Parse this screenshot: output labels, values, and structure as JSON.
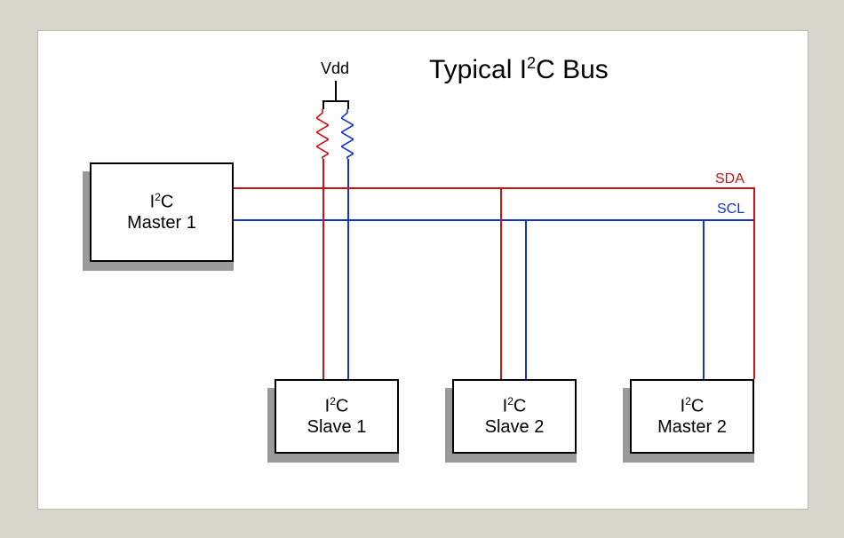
{
  "title_prefix": "Typical I",
  "title_sup": "2",
  "title_suffix": "C Bus",
  "vdd_label": "Vdd",
  "bus": {
    "sda_label": "SDA",
    "scl_label": "SCL"
  },
  "devices": {
    "master1": {
      "line1_pre": "I",
      "line1_sup": "2",
      "line1_post": "C",
      "line2": "Master 1"
    },
    "slave1": {
      "line1_pre": "I",
      "line1_sup": "2",
      "line1_post": "C",
      "line2": "Slave 1"
    },
    "slave2": {
      "line1_pre": "I",
      "line1_sup": "2",
      "line1_post": "C",
      "line2": "Slave 2"
    },
    "master2": {
      "line1_pre": "I",
      "line1_sup": "2",
      "line1_post": "C",
      "line2": "Master 2"
    }
  },
  "colors": {
    "sda": "#cc1111",
    "scl": "#1133cc"
  }
}
